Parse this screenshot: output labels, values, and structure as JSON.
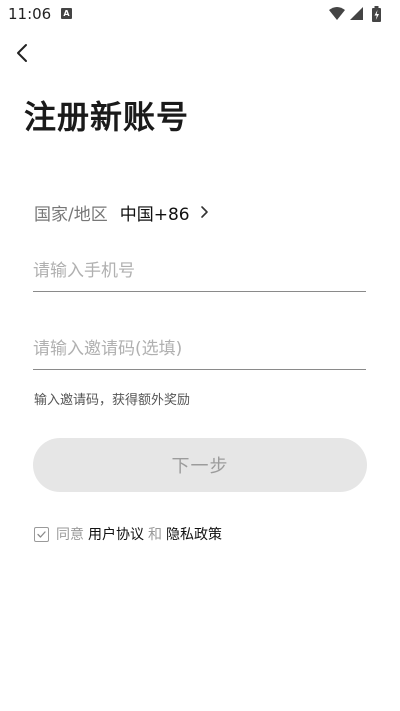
{
  "status_bar": {
    "time": "11:06",
    "notification_glyph": "A",
    "icons": [
      "wifi-icon",
      "signal-icon",
      "battery-charging-icon"
    ]
  },
  "header": {
    "back_icon": "back-arrow-icon",
    "title": "注册新账号"
  },
  "country": {
    "label": "国家/地区",
    "value": "中国+86"
  },
  "phone": {
    "placeholder": "请输入手机号",
    "value": ""
  },
  "invite": {
    "placeholder": "请输入邀请码(选填)",
    "value": "",
    "hint": "输入邀请码，获得额外奖励"
  },
  "next_button": {
    "label": "下一步"
  },
  "agreement": {
    "checked": true,
    "prefix": "同意",
    "user_agreement": "用户协议",
    "conjunction": "和",
    "privacy_policy": "隐私政策"
  },
  "colors": {
    "button_bg": "#e6e6e6",
    "button_text": "#9c9c9c",
    "placeholder": "#b0b0b0"
  }
}
